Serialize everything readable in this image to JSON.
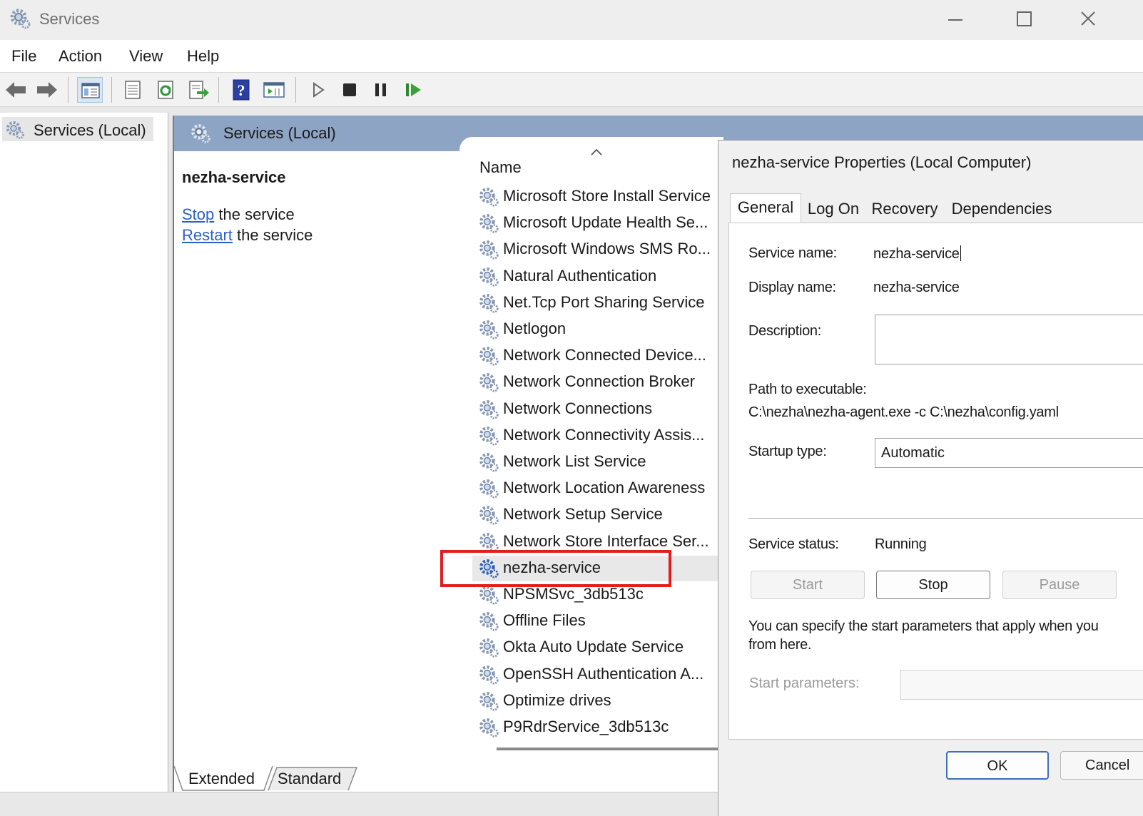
{
  "window": {
    "title": "Services"
  },
  "menu": [
    "File",
    "Action",
    "View",
    "Help"
  ],
  "tree": {
    "root_label": "Services (Local)"
  },
  "pane": {
    "header": "Services (Local)",
    "selected_service": "nezha-service",
    "actions": [
      {
        "link": "Stop",
        "rest": " the service"
      },
      {
        "link": "Restart",
        "rest": " the service"
      }
    ]
  },
  "list": {
    "column_name": "Name",
    "rows": [
      "Microsoft Store Install Service",
      "Microsoft Update Health Se...",
      "Microsoft Windows SMS Ro...",
      "Natural Authentication",
      "Net.Tcp Port Sharing Service",
      "Netlogon",
      "Network Connected Device...",
      "Network Connection Broker",
      "Network Connections",
      "Network Connectivity Assis...",
      "Network List Service",
      "Network Location Awareness",
      "Network Setup Service",
      "Network Store Interface Ser...",
      "nezha-service",
      "NPSMSvc_3db513c",
      "Offline Files",
      "Okta Auto Update Service",
      "OpenSSH Authentication A...",
      "Optimize drives",
      "P9RdrService_3db513c"
    ],
    "selected_index": 14
  },
  "bottom_tabs": [
    "Extended",
    "Standard"
  ],
  "dialog": {
    "title": "nezha-service Properties (Local Computer)",
    "tabs": [
      "General",
      "Log On",
      "Recovery",
      "Dependencies"
    ],
    "active_tab": "General",
    "service_name_label": "Service name:",
    "service_name": "nezha-service",
    "display_name_label": "Display name:",
    "display_name": "nezha-service",
    "description_label": "Description:",
    "description": "",
    "path_label": "Path to executable:",
    "path": "C:\\nezha\\nezha-agent.exe -c C:\\nezha\\config.yaml",
    "startup_type_label": "Startup type:",
    "startup_type": "Automatic",
    "status_label": "Service status:",
    "status": "Running",
    "buttons": {
      "start": "Start",
      "stop": "Stop",
      "pause": "Pause"
    },
    "info_text": "You can specify the start parameters that apply when you\nfrom here.",
    "params_label": "Start parameters:",
    "ok": "OK",
    "cancel": "Cancel"
  },
  "colors": {
    "pane_header": "#8ea4c4",
    "link": "#2b5fc8",
    "highlight_box": "#e02020",
    "selection": "#e8e8e8"
  }
}
